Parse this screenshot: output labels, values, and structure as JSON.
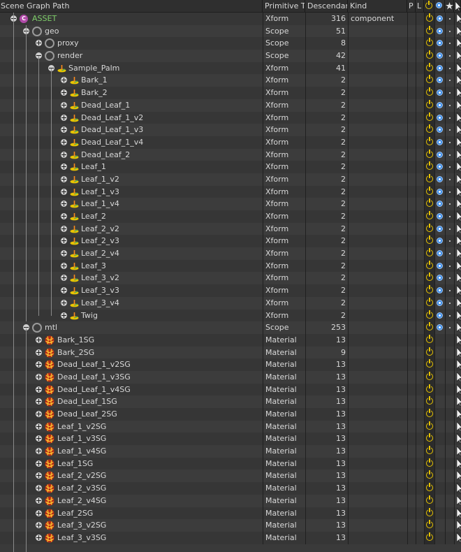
{
  "header": {
    "path": "Scene Graph Path",
    "prim_type": "Primitive T",
    "descendants": "Descendan",
    "kind": "Kind",
    "p": "P",
    "l": "L",
    "active_icon": "power-icon",
    "visible_icon": "eye-icon",
    "star_icon": "star-icon"
  },
  "colors": {
    "power": "#e8c400",
    "eye": "#3e8de8",
    "component": "#b04aa8",
    "asset_text": "#7fcf6a"
  },
  "rows": [
    {
      "name": "ASSET",
      "depth": 1,
      "expand": "minus",
      "icon": "component",
      "type": "Xform",
      "desc": "316",
      "kind": "component",
      "extra": true
    },
    {
      "name": "geo",
      "depth": 2,
      "expand": "minus",
      "icon": "scope",
      "type": "Scope",
      "desc": "51",
      "kind": "",
      "extra": true
    },
    {
      "name": "proxy",
      "depth": 3,
      "expand": "plus",
      "icon": "scope",
      "type": "Scope",
      "desc": "8",
      "kind": "",
      "extra": true
    },
    {
      "name": "render",
      "depth": 3,
      "expand": "minus",
      "icon": "scope",
      "type": "Scope",
      "desc": "42",
      "kind": "",
      "extra": true
    },
    {
      "name": "Sample_Palm",
      "depth": 4,
      "expand": "minus",
      "icon": "xform",
      "type": "Xform",
      "desc": "41",
      "kind": "",
      "extra": true
    },
    {
      "name": "Bark_1",
      "depth": 5,
      "expand": "plus",
      "icon": "xform",
      "type": "Xform",
      "desc": "2",
      "kind": "",
      "extra": true
    },
    {
      "name": "Bark_2",
      "depth": 5,
      "expand": "plus",
      "icon": "xform",
      "type": "Xform",
      "desc": "2",
      "kind": "",
      "extra": true
    },
    {
      "name": "Dead_Leaf_1",
      "depth": 5,
      "expand": "plus",
      "icon": "xform",
      "type": "Xform",
      "desc": "2",
      "kind": "",
      "extra": true
    },
    {
      "name": "Dead_Leaf_1_v2",
      "depth": 5,
      "expand": "plus",
      "icon": "xform",
      "type": "Xform",
      "desc": "2",
      "kind": "",
      "extra": true
    },
    {
      "name": "Dead_Leaf_1_v3",
      "depth": 5,
      "expand": "plus",
      "icon": "xform",
      "type": "Xform",
      "desc": "2",
      "kind": "",
      "extra": true
    },
    {
      "name": "Dead_Leaf_1_v4",
      "depth": 5,
      "expand": "plus",
      "icon": "xform",
      "type": "Xform",
      "desc": "2",
      "kind": "",
      "extra": true
    },
    {
      "name": "Dead_Leaf_2",
      "depth": 5,
      "expand": "plus",
      "icon": "xform",
      "type": "Xform",
      "desc": "2",
      "kind": "",
      "extra": true
    },
    {
      "name": "Leaf_1",
      "depth": 5,
      "expand": "plus",
      "icon": "xform",
      "type": "Xform",
      "desc": "2",
      "kind": "",
      "extra": true
    },
    {
      "name": "Leaf_1_v2",
      "depth": 5,
      "expand": "plus",
      "icon": "xform",
      "type": "Xform",
      "desc": "2",
      "kind": "",
      "extra": true
    },
    {
      "name": "Leaf_1_v3",
      "depth": 5,
      "expand": "plus",
      "icon": "xform",
      "type": "Xform",
      "desc": "2",
      "kind": "",
      "extra": true
    },
    {
      "name": "Leaf_1_v4",
      "depth": 5,
      "expand": "plus",
      "icon": "xform",
      "type": "Xform",
      "desc": "2",
      "kind": "",
      "extra": true
    },
    {
      "name": "Leaf_2",
      "depth": 5,
      "expand": "plus",
      "icon": "xform",
      "type": "Xform",
      "desc": "2",
      "kind": "",
      "extra": true
    },
    {
      "name": "Leaf_2_v2",
      "depth": 5,
      "expand": "plus",
      "icon": "xform",
      "type": "Xform",
      "desc": "2",
      "kind": "",
      "extra": true
    },
    {
      "name": "Leaf_2_v3",
      "depth": 5,
      "expand": "plus",
      "icon": "xform",
      "type": "Xform",
      "desc": "2",
      "kind": "",
      "extra": true
    },
    {
      "name": "Leaf_2_v4",
      "depth": 5,
      "expand": "plus",
      "icon": "xform",
      "type": "Xform",
      "desc": "2",
      "kind": "",
      "extra": true
    },
    {
      "name": "Leaf_3",
      "depth": 5,
      "expand": "plus",
      "icon": "xform",
      "type": "Xform",
      "desc": "2",
      "kind": "",
      "extra": true
    },
    {
      "name": "Leaf_3_v2",
      "depth": 5,
      "expand": "plus",
      "icon": "xform",
      "type": "Xform",
      "desc": "2",
      "kind": "",
      "extra": true
    },
    {
      "name": "Leaf_3_v3",
      "depth": 5,
      "expand": "plus",
      "icon": "xform",
      "type": "Xform",
      "desc": "2",
      "kind": "",
      "extra": true
    },
    {
      "name": "Leaf_3_v4",
      "depth": 5,
      "expand": "plus",
      "icon": "xform",
      "type": "Xform",
      "desc": "2",
      "kind": "",
      "extra": true
    },
    {
      "name": "Twig",
      "depth": 5,
      "expand": "plus",
      "icon": "xform",
      "type": "Xform",
      "desc": "2",
      "kind": "",
      "extra": true
    },
    {
      "name": "mtl",
      "depth": 2,
      "expand": "minus",
      "icon": "scope",
      "type": "Scope",
      "desc": "253",
      "kind": "",
      "extra": true
    },
    {
      "name": "Bark_1SG",
      "depth": 3,
      "expand": "plus",
      "icon": "material",
      "type": "Material",
      "desc": "13",
      "kind": "",
      "extra": false
    },
    {
      "name": "Bark_2SG",
      "depth": 3,
      "expand": "plus",
      "icon": "material",
      "type": "Material",
      "desc": "9",
      "kind": "",
      "extra": false
    },
    {
      "name": "Dead_Leaf_1_v2SG",
      "depth": 3,
      "expand": "plus",
      "icon": "material",
      "type": "Material",
      "desc": "13",
      "kind": "",
      "extra": false
    },
    {
      "name": "Dead_Leaf_1_v3SG",
      "depth": 3,
      "expand": "plus",
      "icon": "material",
      "type": "Material",
      "desc": "13",
      "kind": "",
      "extra": false
    },
    {
      "name": "Dead_Leaf_1_v4SG",
      "depth": 3,
      "expand": "plus",
      "icon": "material",
      "type": "Material",
      "desc": "13",
      "kind": "",
      "extra": false
    },
    {
      "name": "Dead_Leaf_1SG",
      "depth": 3,
      "expand": "plus",
      "icon": "material",
      "type": "Material",
      "desc": "13",
      "kind": "",
      "extra": false
    },
    {
      "name": "Dead_Leaf_2SG",
      "depth": 3,
      "expand": "plus",
      "icon": "material",
      "type": "Material",
      "desc": "13",
      "kind": "",
      "extra": false
    },
    {
      "name": "Leaf_1_v2SG",
      "depth": 3,
      "expand": "plus",
      "icon": "material",
      "type": "Material",
      "desc": "13",
      "kind": "",
      "extra": false
    },
    {
      "name": "Leaf_1_v3SG",
      "depth": 3,
      "expand": "plus",
      "icon": "material",
      "type": "Material",
      "desc": "13",
      "kind": "",
      "extra": false
    },
    {
      "name": "Leaf_1_v4SG",
      "depth": 3,
      "expand": "plus",
      "icon": "material",
      "type": "Material",
      "desc": "13",
      "kind": "",
      "extra": false
    },
    {
      "name": "Leaf_1SG",
      "depth": 3,
      "expand": "plus",
      "icon": "material",
      "type": "Material",
      "desc": "13",
      "kind": "",
      "extra": false
    },
    {
      "name": "Leaf_2_v2SG",
      "depth": 3,
      "expand": "plus",
      "icon": "material",
      "type": "Material",
      "desc": "13",
      "kind": "",
      "extra": false
    },
    {
      "name": "Leaf_2_v3SG",
      "depth": 3,
      "expand": "plus",
      "icon": "material",
      "type": "Material",
      "desc": "13",
      "kind": "",
      "extra": false
    },
    {
      "name": "Leaf_2_v4SG",
      "depth": 3,
      "expand": "plus",
      "icon": "material",
      "type": "Material",
      "desc": "13",
      "kind": "",
      "extra": false
    },
    {
      "name": "Leaf_2SG",
      "depth": 3,
      "expand": "plus",
      "icon": "material",
      "type": "Material",
      "desc": "13",
      "kind": "",
      "extra": false
    },
    {
      "name": "Leaf_3_v2SG",
      "depth": 3,
      "expand": "plus",
      "icon": "material",
      "type": "Material",
      "desc": "13",
      "kind": "",
      "extra": false
    },
    {
      "name": "Leaf_3_v3SG",
      "depth": 3,
      "expand": "plus",
      "icon": "material",
      "type": "Material",
      "desc": "13",
      "kind": "",
      "extra": false
    }
  ]
}
